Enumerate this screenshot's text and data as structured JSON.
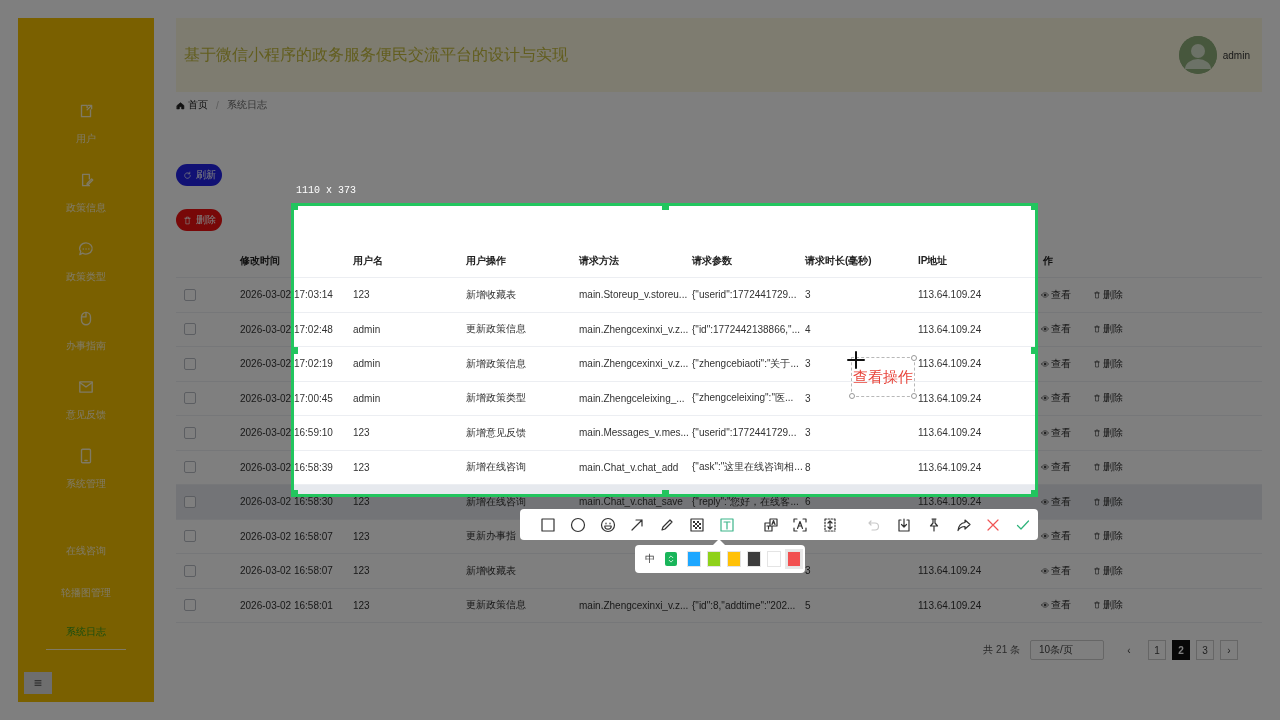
{
  "sidebar": {
    "items": [
      {
        "label": "用户",
        "kind": "document",
        "selected": false
      },
      {
        "label": "政策信息",
        "kind": "edit",
        "selected": false
      },
      {
        "label": "政策类型",
        "kind": "chat",
        "selected": false
      },
      {
        "label": "办事指南",
        "kind": "mouse",
        "selected": false
      },
      {
        "label": "意见反馈",
        "kind": "mail",
        "selected": false
      },
      {
        "label": "系统管理",
        "kind": "phone",
        "selected": false
      },
      {
        "label": "在线咨询",
        "kind": "text",
        "selected": false
      },
      {
        "label": "轮播图管理",
        "kind": "text",
        "selected": false
      },
      {
        "label": "系统日志",
        "kind": "text",
        "selected": true
      }
    ]
  },
  "header": {
    "title": "基于微信小程序的政务服务便民交流平台的设计与实现",
    "user": "admin"
  },
  "breadcrumb": [
    "首页",
    "/",
    "系统日志"
  ],
  "buttons": [
    {
      "label": "刷新",
      "kind": "refresh"
    },
    {
      "label": "删除",
      "kind": "delete"
    }
  ],
  "table": {
    "columns": [
      "修改时间",
      "用户名",
      "用户操作",
      "请求方法",
      "请求参数",
      "请求时长(毫秒)",
      "IP地址",
      "作"
    ],
    "rows": [
      {
        "checked": false,
        "highlighted": false,
        "cells": [
          "2026-03-02 17:03:14",
          "123",
          "新增收藏表",
          "main.Storeup_v.storeu...",
          "{\"userid\":1772441729...",
          "3",
          "113.64.109.24"
        ],
        "actions": [
          "查看",
          "删除"
        ]
      },
      {
        "checked": false,
        "highlighted": false,
        "cells": [
          "2026-03-02 17:02:48",
          "admin",
          "更新政策信息",
          "main.Zhengcexinxi_v.z...",
          "{\"id\":1772442138866,\"...",
          "4",
          "113.64.109.24"
        ],
        "actions": [
          "查看",
          "删除"
        ]
      },
      {
        "checked": false,
        "highlighted": false,
        "cells": [
          "2026-03-02 17:02:19",
          "admin",
          "新增政策信息",
          "main.Zhengcexinxi_v.z...",
          "{\"zhengcebiaoti\":\"关于...",
          "3",
          "113.64.109.24"
        ],
        "actions": [
          "查看",
          "删除"
        ]
      },
      {
        "checked": false,
        "highlighted": false,
        "cells": [
          "2026-03-02 17:00:45",
          "admin",
          "新增政策类型",
          "main.Zhengceleixing_...",
          "{\"zhengceleixing\":\"医...",
          "3",
          "113.64.109.24"
        ],
        "actions": [
          "查看",
          "删除"
        ]
      },
      {
        "checked": false,
        "highlighted": false,
        "cells": [
          "2026-03-02 16:59:10",
          "123",
          "新增意见反馈",
          "main.Messages_v.mes...",
          "{\"userid\":1772441729...",
          "3",
          "113.64.109.24"
        ],
        "actions": [
          "查看",
          "删除"
        ]
      },
      {
        "checked": false,
        "highlighted": false,
        "cells": [
          "2026-03-02 16:58:39",
          "123",
          "新增在线咨询",
          "main.Chat_v.chat_add",
          "{\"ask\":\"这里在线咨询相...",
          "8",
          "113.64.109.24"
        ],
        "actions": [
          "查看",
          "删除"
        ]
      },
      {
        "checked": false,
        "highlighted": true,
        "cells": [
          "2026-03-02 16:58:30",
          "123",
          "新增在线咨询",
          "main.Chat_v.chat_save",
          "{\"reply\":\"您好，在线客...",
          "6",
          "113.64.109.24"
        ],
        "actions": [
          "查看",
          "删除"
        ]
      },
      {
        "checked": false,
        "highlighted": false,
        "cells": [
          "2026-03-02 16:58:07",
          "123",
          "更新办事指",
          null,
          null,
          null,
          null
        ],
        "actions": [
          "查看",
          "删除"
        ]
      },
      {
        "checked": false,
        "highlighted": false,
        "cells": [
          "2026-03-02 16:58:07",
          "123",
          "新增收藏表",
          null,
          null,
          "3",
          "113.64.109.24"
        ],
        "actions": [
          "查看",
          "删除"
        ]
      },
      {
        "checked": false,
        "highlighted": false,
        "cells": [
          "2026-03-02 16:58:01",
          "123",
          "更新政策信息",
          "main.Zhengcexinxi_v.z...",
          "{\"id\":8,\"addtime\":\"202...",
          "5",
          "113.64.109.24"
        ],
        "actions": [
          "查看",
          "删除"
        ]
      }
    ]
  },
  "pagination": {
    "total": "共 21 条",
    "page_size": "10条/页",
    "prev": "‹",
    "next": "›",
    "pages": [
      {
        "label": "1",
        "selected": false
      },
      {
        "label": "2",
        "selected": true
      },
      {
        "label": "3",
        "selected": false
      }
    ]
  },
  "screenshot_tool": {
    "size": "1110 x 373",
    "annotation": "查看操作",
    "tools": [
      {
        "kind": "rectangle",
        "selected": false
      },
      {
        "kind": "ellipse",
        "selected": false
      },
      {
        "kind": "emoji",
        "selected": false
      },
      {
        "kind": "arrow",
        "selected": false
      },
      {
        "kind": "pencil",
        "selected": false
      },
      {
        "kind": "mosaic",
        "selected": false
      },
      {
        "kind": "text",
        "selected": true
      }
    ],
    "capture_tools": [
      {
        "kind": "translate"
      },
      {
        "kind": "ocr"
      },
      {
        "kind": "scroll"
      }
    ],
    "actions": [
      {
        "kind": "undo",
        "disabled": true
      },
      {
        "kind": "save",
        "disabled": false
      },
      {
        "kind": "pin",
        "disabled": false
      },
      {
        "kind": "share",
        "disabled": false
      },
      {
        "kind": "cancel",
        "disabled": false
      },
      {
        "kind": "confirm",
        "disabled": false
      }
    ],
    "text_size": "中",
    "colors": [
      {
        "color": "#1ea7ff",
        "selected": false
      },
      {
        "color": "#8fd11a",
        "selected": false
      },
      {
        "color": "#ffc107",
        "selected": false
      },
      {
        "color": "#3d3d3d",
        "selected": false
      },
      {
        "color": "#ffffff",
        "selected": false
      },
      {
        "color": "#f25050",
        "selected": true
      }
    ]
  }
}
